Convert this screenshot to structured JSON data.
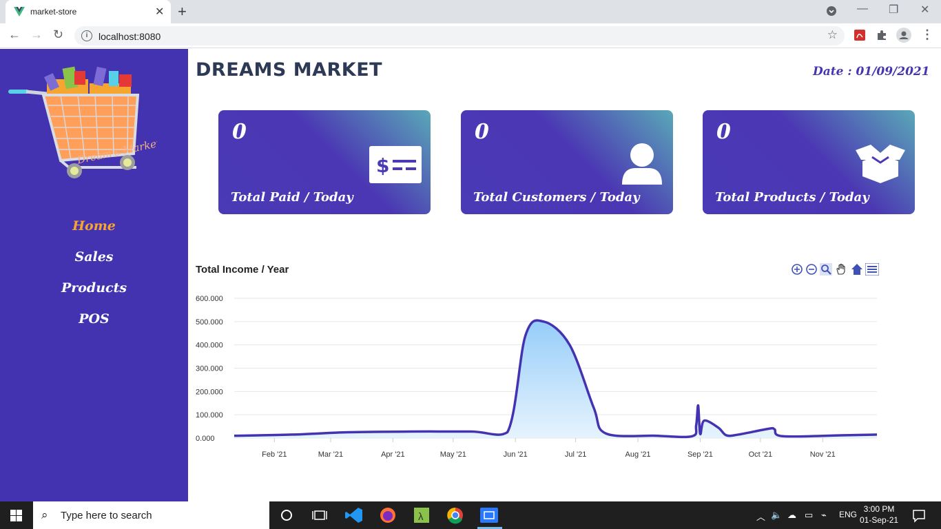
{
  "browser": {
    "tab_title": "market-store",
    "url": "localhost:8080"
  },
  "sidebar": {
    "logo_text": "Dream's Market",
    "items": [
      {
        "label": "Home",
        "active": true
      },
      {
        "label": "Sales",
        "active": false
      },
      {
        "label": "Products",
        "active": false
      },
      {
        "label": "POS",
        "active": false
      }
    ]
  },
  "header": {
    "brand": "DREAMS MARKET",
    "date": "Date : 01/09/2021"
  },
  "cards": [
    {
      "value": "0",
      "label": "Total Paid / Today",
      "icon": "money-check-icon"
    },
    {
      "value": "0",
      "label": "Total Customers / Today",
      "icon": "user-icon"
    },
    {
      "value": "0",
      "label": "Total Products / Today",
      "icon": "box-open-icon"
    }
  ],
  "chart": {
    "title": "Total Income / Year",
    "toolbar": [
      "zoom-in-icon",
      "zoom-out-icon",
      "zoom-selection-icon",
      "pan-hand-icon",
      "reset-home-icon",
      "menu-icon"
    ]
  },
  "chart_data": {
    "type": "area",
    "title": "Total Income / Year",
    "xlabel": "",
    "ylabel": "",
    "x_ticks": [
      "Feb '21",
      "Mar '21",
      "Apr '21",
      "May '21",
      "Jun '21",
      "Jul '21",
      "Aug '21",
      "Sep '21",
      "Oct '21",
      "Nov '21"
    ],
    "y_ticks": [
      "0.000",
      "100.000",
      "200.000",
      "300.000",
      "400.000",
      "500.000",
      "600.000"
    ],
    "ylim": [
      0,
      600000
    ],
    "xlim": [
      "2021-01-12",
      "2021-11-28"
    ],
    "grid": true,
    "colors": {
      "line": "#4333b1",
      "fill_top": "#90caf9",
      "fill_bottom": "#e3f2fd"
    },
    "series": [
      {
        "x": [
          "2021-01-12",
          "2021-02-10",
          "2021-03-10",
          "2021-04-10",
          "2021-05-10",
          "2021-05-28",
          "2021-06-06",
          "2021-06-15",
          "2021-06-28",
          "2021-07-10",
          "2021-07-16",
          "2021-08-10",
          "2021-08-28",
          "2021-08-30",
          "2021-08-31",
          "2021-09-01",
          "2021-09-03",
          "2021-09-10",
          "2021-09-14",
          "2021-09-20",
          "2021-10-05",
          "2021-10-08",
          "2021-10-12",
          "2021-11-10",
          "2021-11-28"
        ],
        "y": [
          10000,
          15000,
          25000,
          28000,
          28000,
          25000,
          440000,
          500000,
          400000,
          130000,
          20000,
          10000,
          8000,
          55000,
          140000,
          18000,
          75000,
          45000,
          12000,
          15000,
          40000,
          38000,
          8000,
          12000,
          15000
        ]
      }
    ]
  },
  "taskbar": {
    "search_placeholder": "Type here to search",
    "language": "ENG",
    "time": "3:00 PM",
    "date": "01-Sep-21"
  }
}
